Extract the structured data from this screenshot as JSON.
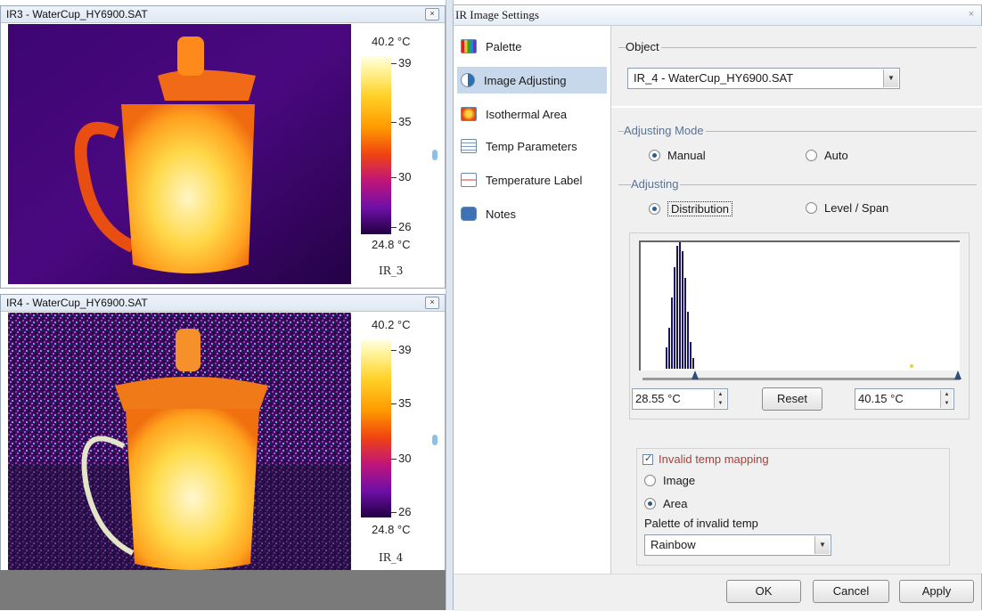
{
  "panels": [
    {
      "title": "IR3 - WaterCup_HY6900.SAT",
      "close": "×",
      "scale": {
        "max": "40.2 °C",
        "min": "24.8 °C",
        "ticks": [
          "39",
          "35",
          "30",
          "26"
        ]
      },
      "image_label": "IR_3",
      "style": "clean"
    },
    {
      "title": "IR4 - WaterCup_HY6900.SAT",
      "close": "×",
      "scale": {
        "max": "40.2 °C",
        "min": "24.8 °C",
        "ticks": [
          "39",
          "35",
          "30",
          "26"
        ]
      },
      "image_label": "IR_4",
      "style": "noisy"
    }
  ],
  "dialog": {
    "title": "IR Image Settings",
    "close": "×",
    "nav": [
      {
        "label": "Palette",
        "icon": "palette-icon",
        "selected": false
      },
      {
        "label": "Image Adjusting",
        "icon": "contrast-icon",
        "selected": true
      },
      {
        "label": "Isothermal Area",
        "icon": "isothermal-icon",
        "selected": false
      },
      {
        "label": "Temp Parameters",
        "icon": "thermometer-icon",
        "selected": false
      },
      {
        "label": "Temperature Label",
        "icon": "temperature-label-icon",
        "selected": false
      },
      {
        "label": "Notes",
        "icon": "notes-icon",
        "selected": false
      }
    ],
    "object": {
      "legend": "Object",
      "value": "IR_4 - WaterCup_HY6900.SAT"
    },
    "adjusting_mode": {
      "legend": "Adjusting Mode",
      "manual": "Manual",
      "auto": "Auto",
      "selected": "Manual"
    },
    "adjusting": {
      "legend": "Adjusting",
      "distribution": "Distribution",
      "level_span": "Level / Span",
      "selected": "Distribution"
    },
    "range": {
      "low": "28.55 °C",
      "high": "40.15 °C",
      "reset": "Reset"
    },
    "invalid": {
      "label": "Invalid temp mapping",
      "checked": true,
      "image": "Image",
      "area": "Area",
      "selected": "Area",
      "palette_label": "Palette of invalid temp",
      "palette_value": "Rainbow"
    },
    "buttons": {
      "ok": "OK",
      "cancel": "Cancel",
      "apply": "Apply"
    }
  }
}
